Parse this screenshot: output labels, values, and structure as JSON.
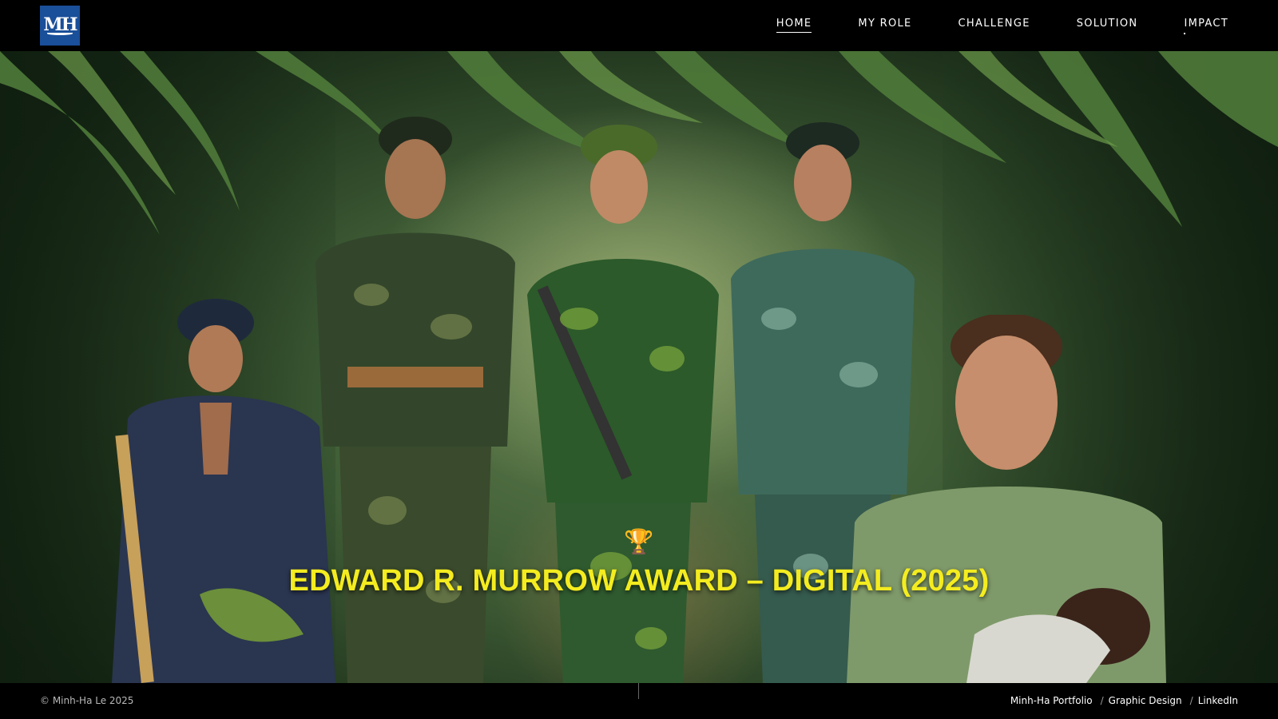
{
  "header": {
    "logo_text": "MH",
    "nav": [
      {
        "label": "HOME",
        "active": true
      },
      {
        "label": "MY ROLE",
        "active": false
      },
      {
        "label": "CHALLENGE",
        "active": false
      },
      {
        "label": "SOLUTION",
        "active": false
      },
      {
        "label": "IMPACT",
        "active": false
      }
    ]
  },
  "hero": {
    "trophy_icon": "trophy-icon",
    "award_title": "EDWARD R. MURROW AWARD – DIGITAL (2025)"
  },
  "footer": {
    "copyright": "© Minh-Ha Le 2025",
    "links": [
      "Minh-Ha Portfolio",
      "Graphic Design",
      "LinkedIn"
    ],
    "separator": "/"
  },
  "colors": {
    "logo_bg": "#1a4f99",
    "award_title": "#f4ec1f",
    "bar_bg": "#000000"
  }
}
